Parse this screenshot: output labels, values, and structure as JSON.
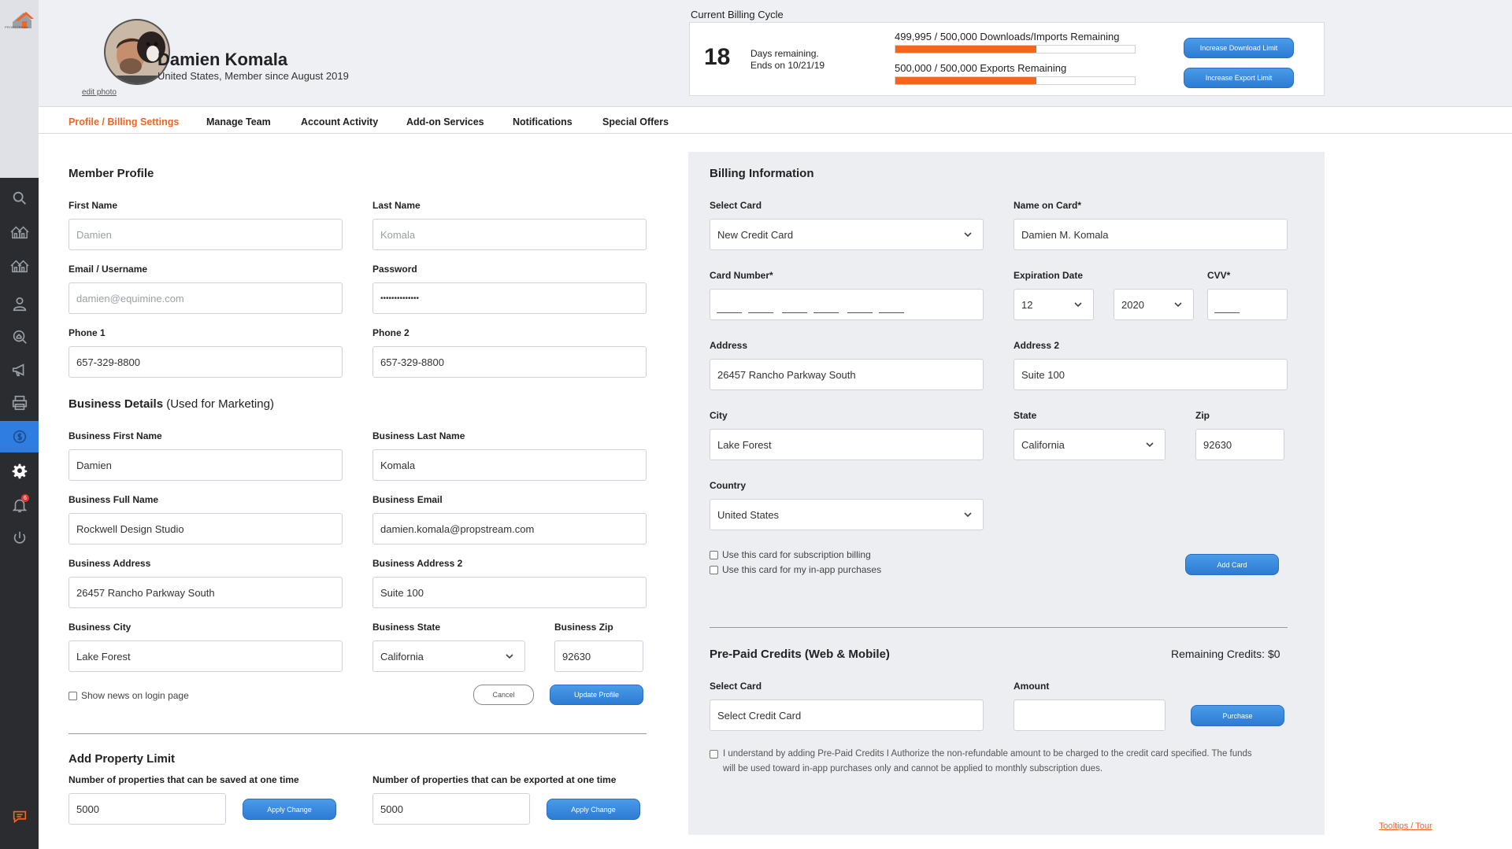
{
  "sidebar": {
    "logo_text": "PROPSTREAM",
    "items": [
      {
        "icon": "search-icon"
      },
      {
        "icon": "homes-icon"
      },
      {
        "icon": "homes-alt-icon"
      },
      {
        "icon": "user-icon"
      },
      {
        "icon": "magnify-property-icon"
      },
      {
        "icon": "megaphone-icon"
      },
      {
        "icon": "printer-icon"
      },
      {
        "icon": "dollar-icon",
        "active": true
      },
      {
        "icon": "gear-icon"
      },
      {
        "icon": "bell-icon",
        "badge": "6"
      },
      {
        "icon": "power-icon"
      }
    ],
    "chat_icon": "chat-icon"
  },
  "header": {
    "edit_photo": "edit photo",
    "name": "Damien Komala",
    "meta": "United States, Member since August 2019",
    "billing_cycle_title": "Current Billing Cycle",
    "days_remaining": "18",
    "days_text_line1": "Days remaining.",
    "days_text_line2": "Ends on 10/21/19",
    "downloads_label": "499,995 / 500,000 Downloads/Imports Remaining",
    "downloads_fill_pct": 59,
    "exports_label": "500,000 / 500,000 Exports Remaining",
    "exports_fill_pct": 59,
    "increase_download_btn": "Increase Download Limit",
    "increase_export_btn": "Increase Export Limit"
  },
  "tabs": [
    {
      "label": "Profile / Billing Settings",
      "active": true
    },
    {
      "label": "Manage Team"
    },
    {
      "label": "Account Activity"
    },
    {
      "label": "Add-on Services"
    },
    {
      "label": "Notifications"
    },
    {
      "label": "Special Offers"
    }
  ],
  "member_profile": {
    "title": "Member Profile",
    "first_name_label": "First Name",
    "first_name_value": "Damien",
    "last_name_label": "Last Name",
    "last_name_value": "Komala",
    "email_label": "Email / Username",
    "email_value": "damien@equimine.com",
    "password_label": "Password",
    "password_value": "••••••••••••••",
    "phone1_label": "Phone 1",
    "phone1_value": "657-329-8800",
    "phone2_label": "Phone 2",
    "phone2_value": "657-329-8800"
  },
  "business": {
    "title": "Business Details",
    "title_sub": " (Used for Marketing)",
    "first_name_label": "Business First Name",
    "first_name_value": "Damien",
    "last_name_label": "Business Last Name",
    "last_name_value": "Komala",
    "full_name_label": "Business Full Name",
    "full_name_value": "Rockwell Design Studio",
    "email_label": "Business Email",
    "email_value": "damien.komala@propstream.com",
    "address_label": "Business Address",
    "address_value": "26457 Rancho Parkway South",
    "address2_label": "Business Address 2",
    "address2_value": "Suite 100",
    "city_label": "Business City",
    "city_value": "Lake Forest",
    "state_label": "Business State",
    "state_value": "California",
    "zip_label": "Business Zip",
    "zip_value": "92630",
    "show_news_label": "Show news on login page",
    "cancel_btn": "Cancel",
    "update_btn": "Update Profile"
  },
  "property_limit": {
    "title": "Add Property Limit",
    "saved_label": "Number of properties that can be saved at one time",
    "saved_value": "5000",
    "exported_label": "Number of properties that can be exported at one time",
    "exported_value": "5000",
    "apply_btn": "Apply Change"
  },
  "billing": {
    "title": "Billing Information",
    "select_card_label": "Select Card",
    "select_card_value": "New Credit Card",
    "name_on_card_label": "Name on Card*",
    "name_on_card_value": "Damien M. Komala",
    "card_number_label": "Card Number*",
    "expiration_label": "Expiration Date",
    "exp_month": "12",
    "exp_year": "2020",
    "cvv_label": "CVV*",
    "address_label": "Address",
    "address_value": "26457 Rancho Parkway South",
    "address2_label": "Address 2",
    "address2_value": "Suite 100",
    "city_label": "City",
    "city_value": "Lake Forest",
    "state_label": "State",
    "state_value": "California",
    "zip_label": "Zip",
    "zip_value": "92630",
    "country_label": "Country",
    "country_value": "United States",
    "use_subscription_label": "Use this card for subscription billing",
    "use_inapp_label": "Use this card for my in-app purchases",
    "add_card_btn": "Add Card"
  },
  "prepaid": {
    "title": "Pre-Paid Credits (Web & Mobile)",
    "remaining": "Remaining Credits: $0",
    "select_card_label": "Select Card",
    "select_card_value": "Select Credit Card",
    "amount_label": "Amount",
    "purchase_btn": "Purchase",
    "disclaimer_line1": "I understand by adding Pre-Paid Credits I Authorize the non-refundable amount to be charged to the credit card specified. The funds",
    "disclaimer_line2": "will be used toward in-app purchases only and cannot be applied to monthly subscription dues."
  },
  "footer": {
    "tooltips_link": "Tooltips / Tour"
  },
  "colors": {
    "accent": "#f26522",
    "primary_button": "#2f7de0",
    "sidebar": "#2b2c30"
  }
}
